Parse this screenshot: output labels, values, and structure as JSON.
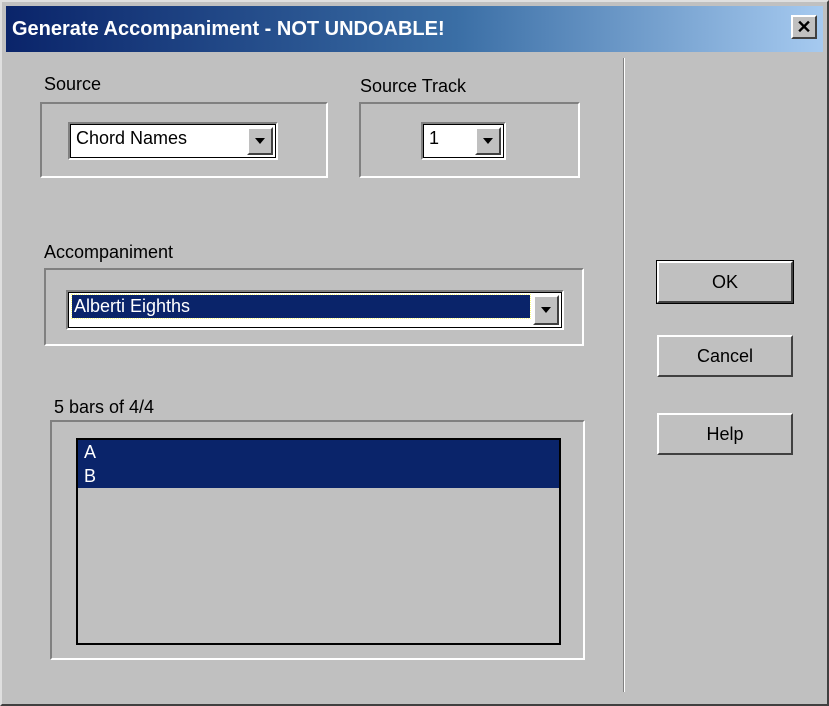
{
  "window": {
    "title": "Generate Accompaniment - NOT UNDOABLE!",
    "close_glyph": "✕"
  },
  "source": {
    "label": "Source",
    "selected": "Chord Names"
  },
  "source_track": {
    "label": "Source Track",
    "selected": "1"
  },
  "accompaniment": {
    "label": "Accompaniment",
    "selected": "Alberti Eighths"
  },
  "sections": {
    "label": "5 bars of 4/4",
    "items": [
      "A",
      "B"
    ]
  },
  "buttons": {
    "ok": "OK",
    "cancel": "Cancel",
    "help": "Help"
  },
  "icons": {
    "close": "close-icon",
    "dropdown": "chevron-down-icon"
  },
  "colors": {
    "face": "#c0c0c0",
    "selection": "#0a246a",
    "title_start": "#0a246a",
    "title_end": "#a6caf0"
  }
}
